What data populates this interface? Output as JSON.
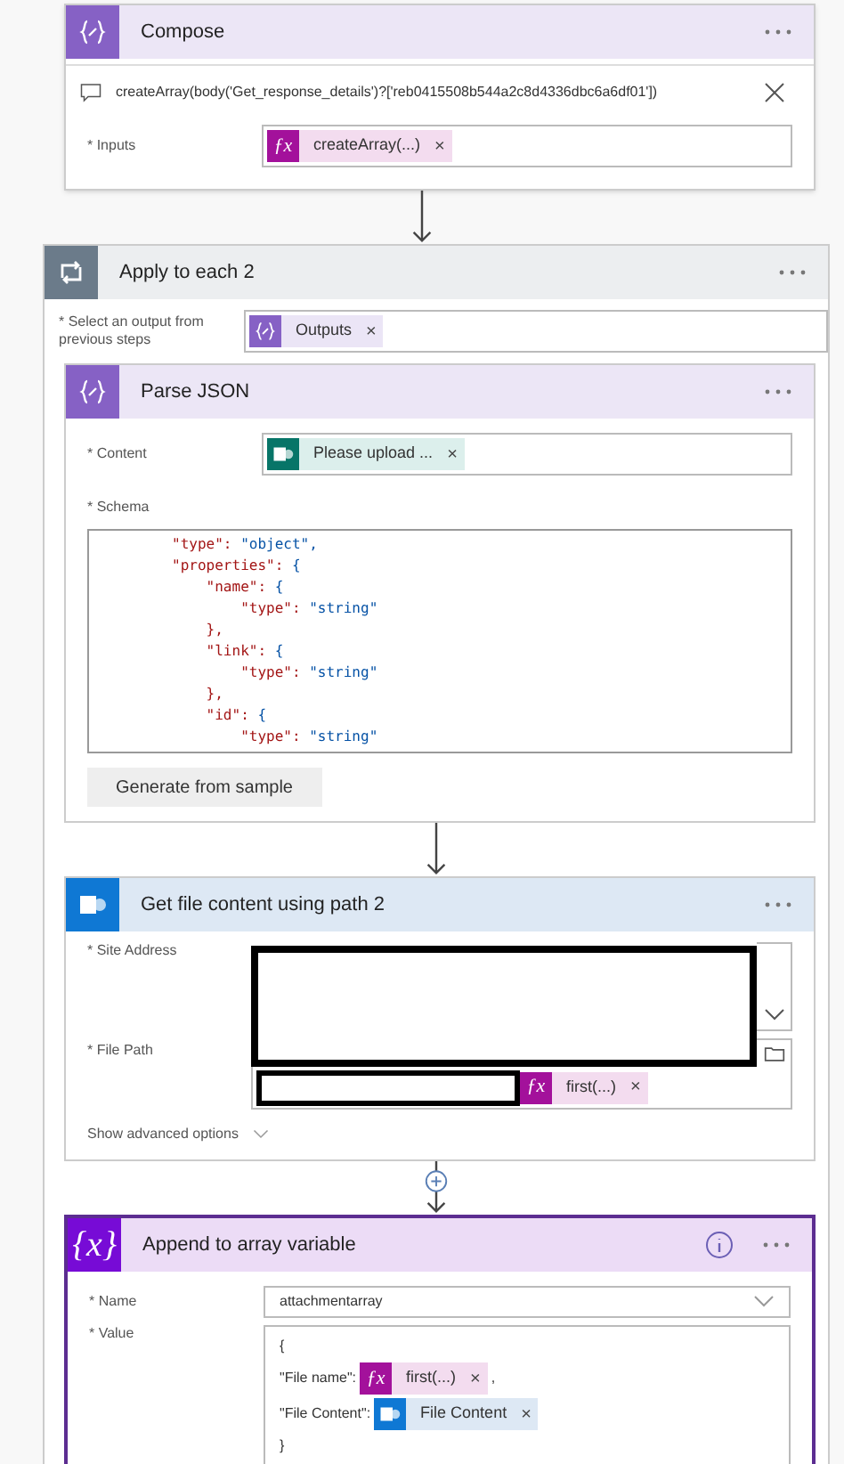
{
  "compose": {
    "kind": "compose",
    "title": "Compose",
    "expression": "createArray(body('Get_response_details')?['reb0415508b544a2c8d4336dbc6a6df01'])",
    "fields": [
      {
        "label": "* Inputs",
        "tokens": [
          {
            "kind": "fx",
            "icon": "ƒx",
            "label": "createArray(...)",
            "remove": "×"
          }
        ]
      }
    ]
  },
  "loop": {
    "kind": "loop",
    "title": "Apply to each 2",
    "select_label": "* Select an output from previous steps",
    "tokens": [
      {
        "kind": "compose",
        "label": "Outputs",
        "remove": "×"
      }
    ],
    "parse_json": {
      "kind": "compose",
      "title": "Parse JSON",
      "content_label": "* Content",
      "tokens": [
        {
          "kind": "forms",
          "label": "Please upload ...",
          "remove": "×"
        }
      ],
      "schema_label": "* Schema",
      "schema_lines": [
        "        \"type\": \"object\",",
        "        \"properties\": {",
        "            \"name\": {",
        "                \"type\": \"string\"",
        "            },",
        "            \"link\": {",
        "                \"type\": \"string\"",
        "            },",
        "            \"id\": {",
        "                \"type\": \"string\""
      ],
      "button": "Generate from sample"
    },
    "get_file": {
      "kind": "sharepoint",
      "title": "Get file content using path 2",
      "site_label": "* Site Address",
      "path_label": "* File Path",
      "path_tokens": [
        {
          "kind": "fx",
          "icon": "ƒx",
          "label": "first(...)",
          "remove": "×"
        }
      ],
      "advanced": "Show advanced options"
    },
    "append": {
      "kind": "variable",
      "icon_text": "{x}",
      "title": "Append to array variable",
      "selected": true,
      "name_label": "* Name",
      "name_value": "attachmentarray",
      "value_label": "* Value",
      "value_lines": [
        [
          {
            "kind": "text",
            "text": "{"
          }
        ],
        [
          {
            "kind": "text",
            "text": "\"File name\":"
          },
          {
            "kind": "fx",
            "icon": "ƒx",
            "label": "first(...)",
            "remove": "×"
          },
          {
            "kind": "text",
            "text": ","
          }
        ],
        [
          {
            "kind": "text",
            "text": "\"File Content\":"
          },
          {
            "kind": "sharepoint",
            "label": "File Content",
            "remove": "×"
          }
        ],
        [
          {
            "kind": "text",
            "text": "}"
          }
        ]
      ]
    }
  }
}
